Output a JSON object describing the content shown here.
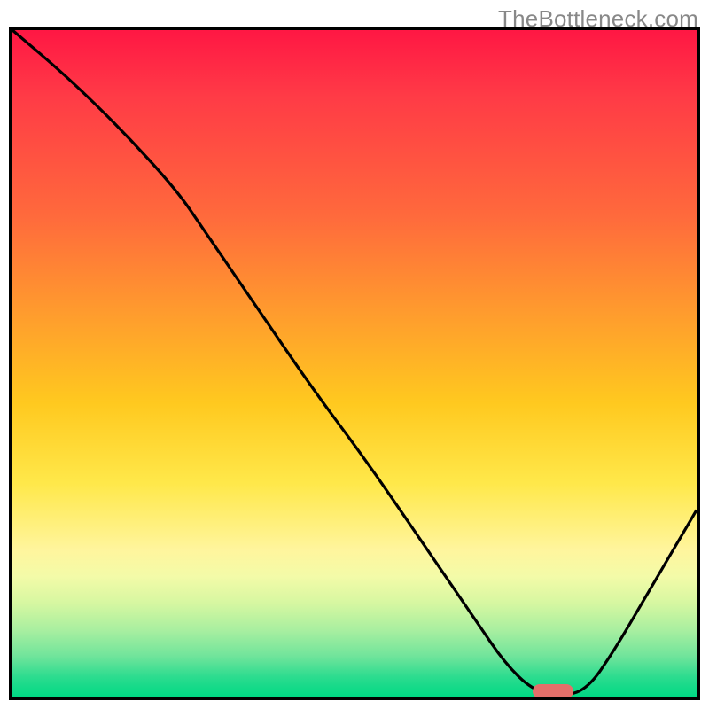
{
  "watermark": "TheBottleneck.com",
  "colors": {
    "border": "#000000",
    "curve": "#000000",
    "marker": "#e46f6a",
    "watermark": "#888888"
  },
  "chart_data": {
    "type": "line",
    "title": "",
    "xlabel": "",
    "ylabel": "",
    "xlim": [
      0,
      100
    ],
    "ylim": [
      0,
      100
    ],
    "x": [
      0,
      8,
      16,
      24,
      28,
      36,
      44,
      52,
      60,
      68,
      72,
      76,
      80,
      84,
      88,
      92,
      96,
      100
    ],
    "values": [
      100,
      93,
      85,
      76,
      70,
      58,
      46,
      35,
      23,
      11,
      5,
      1,
      0,
      1,
      7,
      14,
      21,
      28
    ],
    "marker": {
      "x": 79,
      "y": 0
    },
    "gradient_stops": [
      {
        "pct": 0,
        "color": "#ff1744"
      },
      {
        "pct": 28,
        "color": "#ff6a3c"
      },
      {
        "pct": 56,
        "color": "#ffc91f"
      },
      {
        "pct": 78,
        "color": "#fff59d"
      },
      {
        "pct": 90,
        "color": "#a9efa0"
      },
      {
        "pct": 100,
        "color": "#00d884"
      }
    ]
  }
}
